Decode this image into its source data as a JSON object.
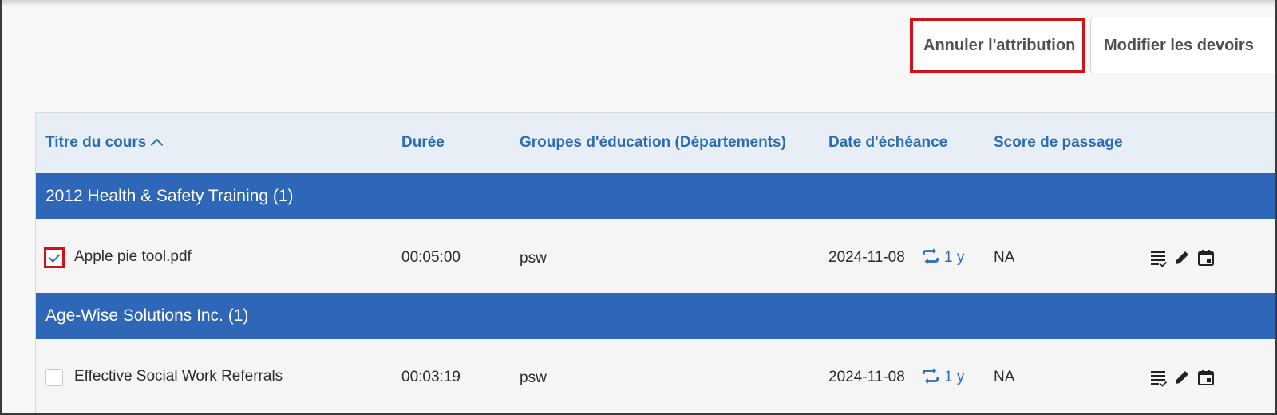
{
  "toolbar": {
    "unassign_label": "Annuler l'attribution",
    "edit_assignments_label": "Modifier les devoirs"
  },
  "table": {
    "headers": {
      "course_title": "Titre du cours",
      "duration": "Durée",
      "groups": "Groupes d'éducation (Départements)",
      "due_date": "Date d'échéance",
      "passing_score": "Score de passage"
    },
    "groups": [
      {
        "title": "2012 Health & Safety Training (1)",
        "rows": [
          {
            "checked": true,
            "title": "Apple pie tool.pdf",
            "duration": "00:05:00",
            "groups": "psw",
            "due_date": "2024-11-08",
            "recurrence": "1 y",
            "passing_score": "NA"
          }
        ]
      },
      {
        "title": "Age-Wise Solutions Inc. (1)",
        "rows": [
          {
            "checked": false,
            "title": "Effective Social Work Referrals",
            "duration": "00:03:19",
            "groups": "psw",
            "due_date": "2024-11-08",
            "recurrence": "1 y",
            "passing_score": "NA"
          }
        ]
      }
    ]
  },
  "icons": {
    "row_actions": [
      "list-check-icon",
      "pencil-icon",
      "calendar-icon"
    ],
    "recurrence": "repeat-icon",
    "sort": "chevron-up-icon"
  },
  "colors": {
    "accent": "#2a6db4",
    "group_header": "#2e67b7",
    "highlight": "#d0131b"
  }
}
